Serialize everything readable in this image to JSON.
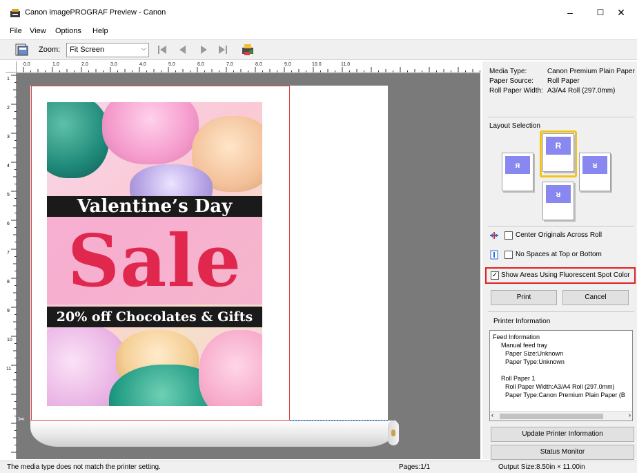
{
  "window": {
    "title": "Canon imagePROGRAF Preview - Canon",
    "minimize": "–",
    "maximize": "☐",
    "close": "✕"
  },
  "menu": [
    "File",
    "View",
    "Options",
    "Help"
  ],
  "toolbar": {
    "zoom_label": "Zoom:",
    "zoom_value": "Fit Screen",
    "icons": [
      "layout-icon",
      "first-page-icon",
      "previous-page-icon",
      "next-page-icon",
      "last-page-icon",
      "printer-settings-icon"
    ]
  },
  "ruler": {
    "h_labels": [
      "0.0",
      "1.0",
      "2.0",
      "3.0",
      "4.0",
      "5.0",
      "6.0",
      "7.0",
      "8.0",
      "9.0",
      "10.0",
      "11.0"
    ],
    "v_labels": [
      "1",
      "2",
      "3",
      "4",
      "5",
      "6",
      "7",
      "8",
      "9",
      "10",
      "11"
    ]
  },
  "poster": {
    "headline": "Valentine’s Day",
    "sale": "Sale",
    "subline": "20% off Chocolates & Gifts"
  },
  "media": {
    "rows": [
      {
        "label": "Media Type:",
        "value": "Canon Premium Plain Paper"
      },
      {
        "label": "Paper Source:",
        "value": "Roll Paper"
      },
      {
        "label": "Roll Paper Width:",
        "value": "A3/A4 Roll (297.0mm)"
      }
    ]
  },
  "layout": {
    "title": "Layout Selection",
    "options": [
      {
        "name": "layout-rotate-left",
        "glyph": "ᴙ"
      },
      {
        "name": "layout-normal",
        "glyph": "R"
      },
      {
        "name": "layout-rotate-right",
        "glyph": "ᴚ"
      },
      {
        "name": "layout-upside-down",
        "glyph": "ᴚ"
      }
    ],
    "selected": "layout-normal"
  },
  "options": {
    "center_originals": "Center Originals Across Roll",
    "no_spaces": "No Spaces at Top or Bottom",
    "fluorescent": "Show Areas Using Fluorescent Spot Color",
    "center_checked": false,
    "no_spaces_checked": false,
    "fluorescent_checked": true
  },
  "buttons": {
    "print": "Print",
    "cancel": "Cancel",
    "update": "Update Printer Information",
    "status": "Status Monitor"
  },
  "printer_info": {
    "title": "Printer Information",
    "lines": [
      "Feed Information",
      "    Manual feed tray",
      "       Paper Size:Unknown",
      "       Paper Type:Unknown",
      "",
      "    Roll Paper 1",
      "       Roll Paper Width:A3/A4 Roll (297.0mm)",
      "       Paper Type:Canon Premium Plain Paper (B"
    ]
  },
  "status": {
    "message": "The media type does not match the printer setting.",
    "pages": "Pages:1/1",
    "output": "Output Size:8.50in × 11.00in"
  },
  "colors": {
    "accent_highlight": "#e02020",
    "selected_layout": "#f2c318",
    "sale_red": "#e0284f",
    "cut_line": "#4a8ad6"
  }
}
